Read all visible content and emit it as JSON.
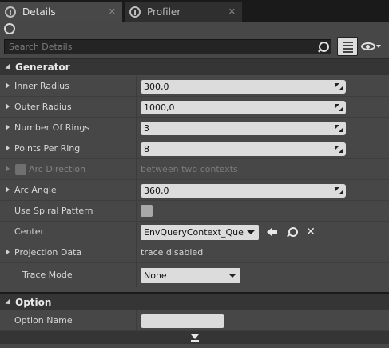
{
  "tabs": [
    {
      "label": "Details",
      "icon": "details-icon",
      "active": true
    },
    {
      "label": "Profiler",
      "icon": "profiler-icon",
      "active": false
    }
  ],
  "search": {
    "placeholder": "Search Details",
    "value": ""
  },
  "sections": {
    "generator": {
      "title": "Generator",
      "inner_radius": {
        "label": "Inner Radius",
        "value": "300,0"
      },
      "outer_radius": {
        "label": "Outer Radius",
        "value": "1000,0"
      },
      "number_of_rings": {
        "label": "Number Of Rings",
        "value": "3"
      },
      "points_per_ring": {
        "label": "Points Per Ring",
        "value": "8"
      },
      "arc_direction": {
        "label": "Arc Direction",
        "value": "between two contexts",
        "enabled": false
      },
      "arc_angle": {
        "label": "Arc Angle",
        "value": "360,0"
      },
      "use_spiral_pattern": {
        "label": "Use Spiral Pattern",
        "checked": false
      },
      "center": {
        "label": "Center",
        "value": "EnvQueryContext_Querier"
      },
      "projection_data": {
        "label": "Projection Data",
        "value": "trace disabled"
      },
      "trace_mode": {
        "label": "Trace Mode",
        "value": "None"
      }
    },
    "option": {
      "title": "Option",
      "option_name": {
        "label": "Option Name",
        "value": ""
      }
    }
  },
  "colors": {
    "panel": "#474747",
    "category_header": "#353535",
    "field": "#dcdcdc",
    "tab_active": "#484848",
    "tab_inactive": "#2f2f2f"
  }
}
